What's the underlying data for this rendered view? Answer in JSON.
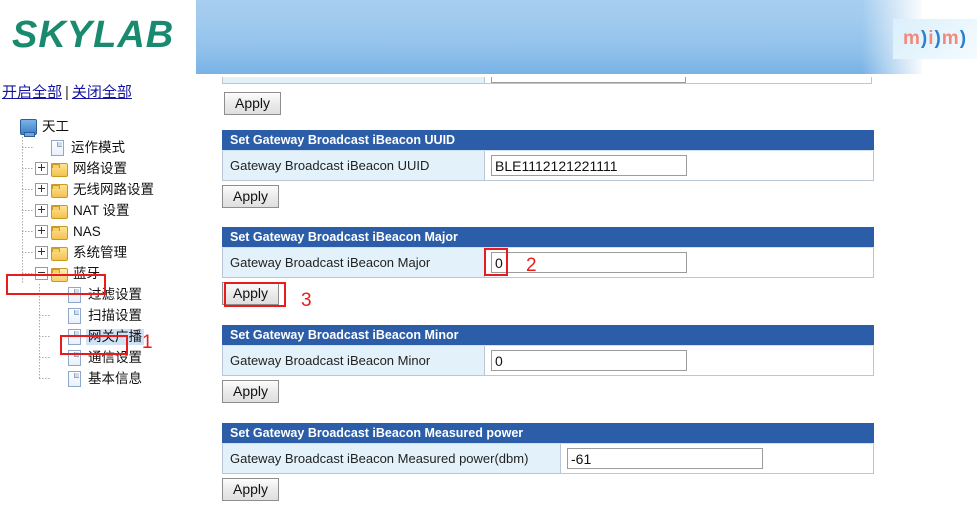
{
  "header": {
    "brand": "SKYLAB",
    "brand_color": "#1a8a6e",
    "right_logo": {
      "m1": "m",
      "p1": ")",
      "i": "i",
      "p2": ")",
      "m2": "m",
      "p3": ")"
    },
    "banner_color": "#8fc0ea"
  },
  "sidebar": {
    "expand_all": "开启全部",
    "separator": "|",
    "collapse_all": "关闭全部",
    "tree": [
      {
        "label": "天工",
        "icon": "computer-icon",
        "level": 1,
        "handle": "none",
        "selected": false
      },
      {
        "label": "运作模式",
        "icon": "page-icon",
        "level": 2,
        "handle": "none",
        "selected": false
      },
      {
        "label": "网络设置",
        "icon": "folder-icon",
        "level": 2,
        "handle": "plus",
        "selected": false
      },
      {
        "label": "无线网路设置",
        "icon": "folder-icon",
        "level": 2,
        "handle": "plus",
        "selected": false
      },
      {
        "label": "NAT 设置",
        "icon": "folder-icon",
        "level": 2,
        "handle": "plus",
        "selected": false
      },
      {
        "label": "NAS",
        "icon": "folder-icon",
        "level": 2,
        "handle": "plus",
        "selected": false
      },
      {
        "label": "系统管理",
        "icon": "folder-icon",
        "level": 2,
        "handle": "plus",
        "selected": false
      },
      {
        "label": "蓝牙",
        "icon": "folder-open-icon",
        "level": 2,
        "handle": "minus",
        "selected": false
      },
      {
        "label": "过滤设置",
        "icon": "page-icon",
        "level": 3,
        "handle": "none",
        "selected": false
      },
      {
        "label": "扫描设置",
        "icon": "page-icon",
        "level": 3,
        "handle": "none",
        "selected": false
      },
      {
        "label": "网关广播",
        "icon": "page-icon",
        "level": 3,
        "handle": "none",
        "selected": true
      },
      {
        "label": "通信设置",
        "icon": "page-icon",
        "level": 3,
        "handle": "none",
        "selected": false
      },
      {
        "label": "基本信息",
        "icon": "page-icon",
        "level": 3,
        "handle": "none",
        "selected": false
      }
    ]
  },
  "main": {
    "apply_label": "Apply",
    "sections": [
      {
        "title": "Set Gateway Broadcast iBeacon UUID",
        "field_label": "Gateway Broadcast iBeacon UUID",
        "value": "BLE1112121221111",
        "apply": "Apply"
      },
      {
        "title": "Set Gateway Broadcast iBeacon Major",
        "field_label": "Gateway Broadcast iBeacon Major",
        "value": "0",
        "apply": "Apply"
      },
      {
        "title": "Set Gateway Broadcast iBeacon Minor",
        "field_label": "Gateway Broadcast iBeacon Minor",
        "value": "0",
        "apply": "Apply"
      },
      {
        "title": "Set Gateway Broadcast iBeacon Measured power",
        "field_label": "Gateway Broadcast iBeacon Measured power(dbm)",
        "value": "-61",
        "apply": "Apply"
      }
    ],
    "top_apply": "Apply",
    "header_bg": "#2b5da8",
    "label_bg": "#e3f2fa"
  },
  "annotations": {
    "color": "#e81c1c",
    "markers": [
      {
        "id": "1",
        "target": "sidebar-item-网关广播"
      },
      {
        "id": "2",
        "target": "major-input"
      },
      {
        "id": "3",
        "target": "major-apply-button"
      }
    ],
    "m1": "1",
    "m2": "2",
    "m3": "3"
  }
}
